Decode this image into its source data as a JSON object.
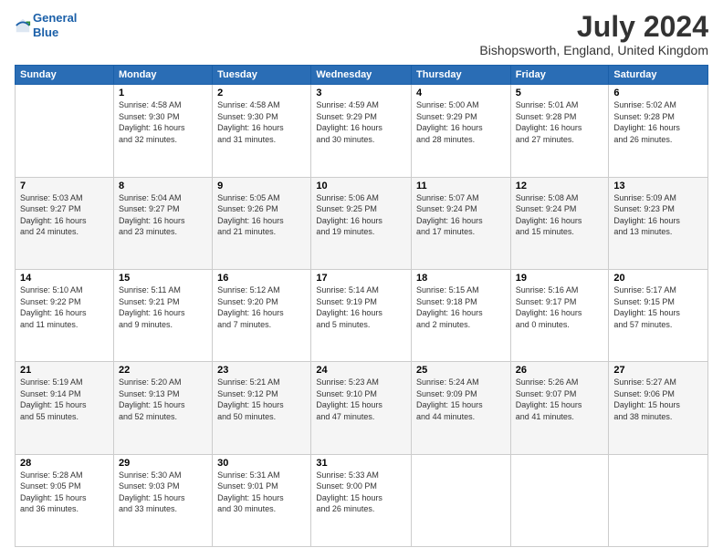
{
  "logo": {
    "line1": "General",
    "line2": "Blue"
  },
  "title": "July 2024",
  "subtitle": "Bishopsworth, England, United Kingdom",
  "days": [
    "Sunday",
    "Monday",
    "Tuesday",
    "Wednesday",
    "Thursday",
    "Friday",
    "Saturday"
  ],
  "weeks": [
    [
      {
        "date": "",
        "info": ""
      },
      {
        "date": "1",
        "info": "Sunrise: 4:58 AM\nSunset: 9:30 PM\nDaylight: 16 hours\nand 32 minutes."
      },
      {
        "date": "2",
        "info": "Sunrise: 4:58 AM\nSunset: 9:30 PM\nDaylight: 16 hours\nand 31 minutes."
      },
      {
        "date": "3",
        "info": "Sunrise: 4:59 AM\nSunset: 9:29 PM\nDaylight: 16 hours\nand 30 minutes."
      },
      {
        "date": "4",
        "info": "Sunrise: 5:00 AM\nSunset: 9:29 PM\nDaylight: 16 hours\nand 28 minutes."
      },
      {
        "date": "5",
        "info": "Sunrise: 5:01 AM\nSunset: 9:28 PM\nDaylight: 16 hours\nand 27 minutes."
      },
      {
        "date": "6",
        "info": "Sunrise: 5:02 AM\nSunset: 9:28 PM\nDaylight: 16 hours\nand 26 minutes."
      }
    ],
    [
      {
        "date": "7",
        "info": "Sunrise: 5:03 AM\nSunset: 9:27 PM\nDaylight: 16 hours\nand 24 minutes."
      },
      {
        "date": "8",
        "info": "Sunrise: 5:04 AM\nSunset: 9:27 PM\nDaylight: 16 hours\nand 23 minutes."
      },
      {
        "date": "9",
        "info": "Sunrise: 5:05 AM\nSunset: 9:26 PM\nDaylight: 16 hours\nand 21 minutes."
      },
      {
        "date": "10",
        "info": "Sunrise: 5:06 AM\nSunset: 9:25 PM\nDaylight: 16 hours\nand 19 minutes."
      },
      {
        "date": "11",
        "info": "Sunrise: 5:07 AM\nSunset: 9:24 PM\nDaylight: 16 hours\nand 17 minutes."
      },
      {
        "date": "12",
        "info": "Sunrise: 5:08 AM\nSunset: 9:24 PM\nDaylight: 16 hours\nand 15 minutes."
      },
      {
        "date": "13",
        "info": "Sunrise: 5:09 AM\nSunset: 9:23 PM\nDaylight: 16 hours\nand 13 minutes."
      }
    ],
    [
      {
        "date": "14",
        "info": "Sunrise: 5:10 AM\nSunset: 9:22 PM\nDaylight: 16 hours\nand 11 minutes."
      },
      {
        "date": "15",
        "info": "Sunrise: 5:11 AM\nSunset: 9:21 PM\nDaylight: 16 hours\nand 9 minutes."
      },
      {
        "date": "16",
        "info": "Sunrise: 5:12 AM\nSunset: 9:20 PM\nDaylight: 16 hours\nand 7 minutes."
      },
      {
        "date": "17",
        "info": "Sunrise: 5:14 AM\nSunset: 9:19 PM\nDaylight: 16 hours\nand 5 minutes."
      },
      {
        "date": "18",
        "info": "Sunrise: 5:15 AM\nSunset: 9:18 PM\nDaylight: 16 hours\nand 2 minutes."
      },
      {
        "date": "19",
        "info": "Sunrise: 5:16 AM\nSunset: 9:17 PM\nDaylight: 16 hours\nand 0 minutes."
      },
      {
        "date": "20",
        "info": "Sunrise: 5:17 AM\nSunset: 9:15 PM\nDaylight: 15 hours\nand 57 minutes."
      }
    ],
    [
      {
        "date": "21",
        "info": "Sunrise: 5:19 AM\nSunset: 9:14 PM\nDaylight: 15 hours\nand 55 minutes."
      },
      {
        "date": "22",
        "info": "Sunrise: 5:20 AM\nSunset: 9:13 PM\nDaylight: 15 hours\nand 52 minutes."
      },
      {
        "date": "23",
        "info": "Sunrise: 5:21 AM\nSunset: 9:12 PM\nDaylight: 15 hours\nand 50 minutes."
      },
      {
        "date": "24",
        "info": "Sunrise: 5:23 AM\nSunset: 9:10 PM\nDaylight: 15 hours\nand 47 minutes."
      },
      {
        "date": "25",
        "info": "Sunrise: 5:24 AM\nSunset: 9:09 PM\nDaylight: 15 hours\nand 44 minutes."
      },
      {
        "date": "26",
        "info": "Sunrise: 5:26 AM\nSunset: 9:07 PM\nDaylight: 15 hours\nand 41 minutes."
      },
      {
        "date": "27",
        "info": "Sunrise: 5:27 AM\nSunset: 9:06 PM\nDaylight: 15 hours\nand 38 minutes."
      }
    ],
    [
      {
        "date": "28",
        "info": "Sunrise: 5:28 AM\nSunset: 9:05 PM\nDaylight: 15 hours\nand 36 minutes."
      },
      {
        "date": "29",
        "info": "Sunrise: 5:30 AM\nSunset: 9:03 PM\nDaylight: 15 hours\nand 33 minutes."
      },
      {
        "date": "30",
        "info": "Sunrise: 5:31 AM\nSunset: 9:01 PM\nDaylight: 15 hours\nand 30 minutes."
      },
      {
        "date": "31",
        "info": "Sunrise: 5:33 AM\nSunset: 9:00 PM\nDaylight: 15 hours\nand 26 minutes."
      },
      {
        "date": "",
        "info": ""
      },
      {
        "date": "",
        "info": ""
      },
      {
        "date": "",
        "info": ""
      }
    ]
  ]
}
